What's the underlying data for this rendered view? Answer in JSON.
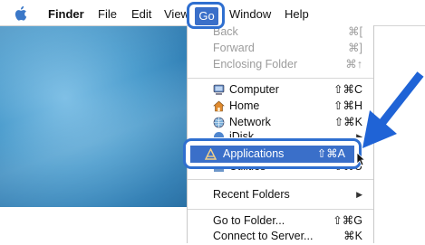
{
  "menubar": {
    "finder": "Finder",
    "file": "File",
    "edit": "Edit",
    "view": "View",
    "go": "Go",
    "window": "Window",
    "help": "Help"
  },
  "go_menu": {
    "back": {
      "label": "Back",
      "shortcut": "⌘["
    },
    "forward": {
      "label": "Forward",
      "shortcut": "⌘]"
    },
    "enclosing": {
      "label": "Enclosing Folder",
      "shortcut": "⌘↑"
    },
    "computer": {
      "label": "Computer",
      "shortcut": "⇧⌘C"
    },
    "home": {
      "label": "Home",
      "shortcut": "⇧⌘H"
    },
    "network": {
      "label": "Network",
      "shortcut": "⇧⌘K"
    },
    "idisk": {
      "label": "iDisk"
    },
    "applications": {
      "label": "Applications",
      "shortcut": "⇧⌘A"
    },
    "utilities": {
      "label": "Utilities",
      "shortcut": "⇧⌘U"
    },
    "recent": {
      "label": "Recent Folders"
    },
    "goto": {
      "label": "Go to Folder...",
      "shortcut": "⇧⌘G"
    },
    "connect": {
      "label": "Connect to Server...",
      "shortcut": "⌘K"
    }
  },
  "colors": {
    "highlight": "#3a6fc9",
    "callout_border": "#2f6fd0",
    "arrow": "#1f63d6"
  }
}
